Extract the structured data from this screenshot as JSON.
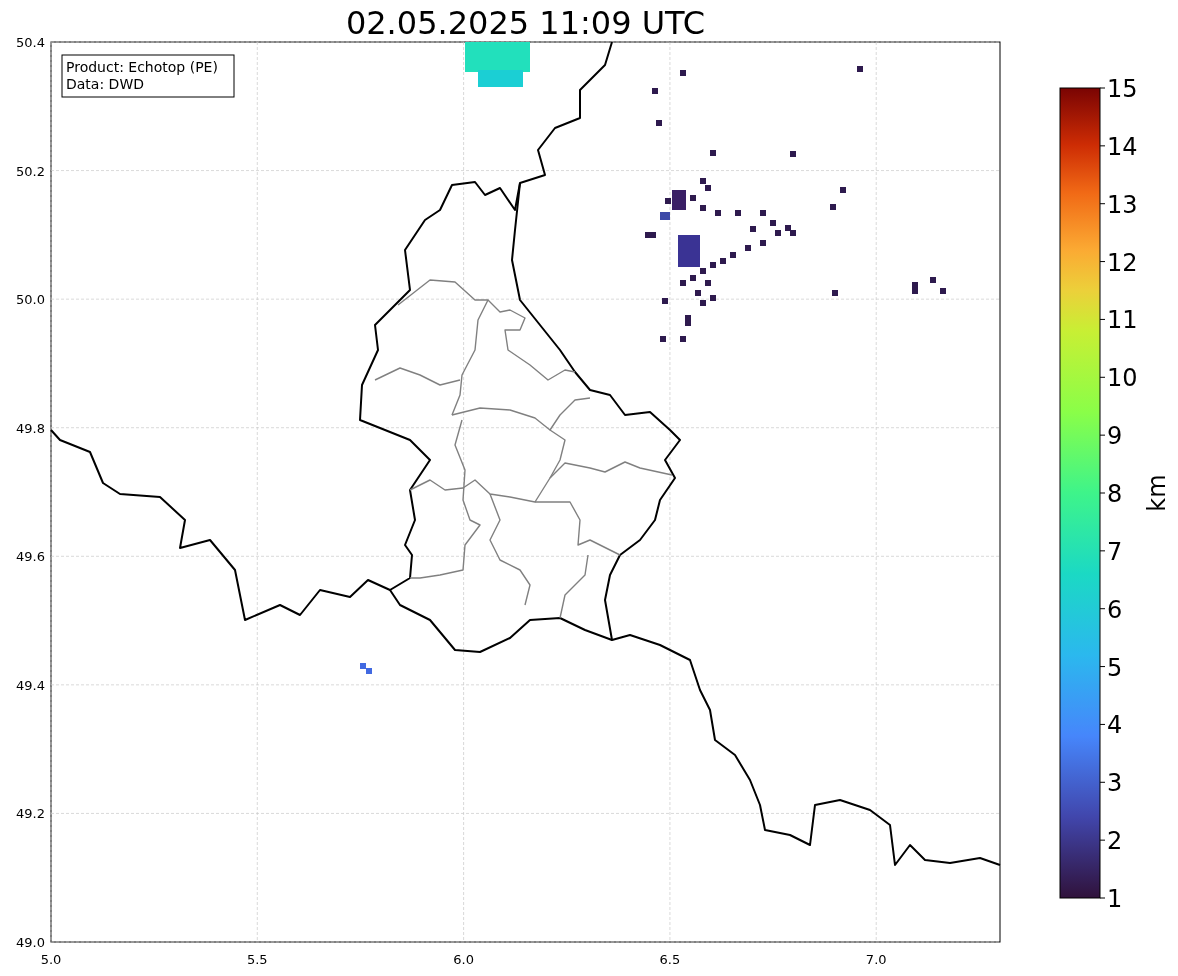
{
  "title": "02.05.2025 11:09 UTC",
  "legend_box": {
    "lines": [
      "Product: Echotop (PE)",
      "Data: DWD"
    ]
  },
  "x_ticks": [
    "5.0",
    "5.5",
    "6.0",
    "6.5",
    "7.0"
  ],
  "y_ticks": [
    "50.4",
    "50.2",
    "50.0",
    "49.8",
    "49.6",
    "49.4",
    "49.2",
    "49.0"
  ],
  "colorbar": {
    "label": "km",
    "ticks": [
      "15",
      "14",
      "13",
      "12",
      "11",
      "10",
      "9",
      "8",
      "7",
      "6",
      "5",
      "4",
      "3",
      "2",
      "1"
    ]
  }
}
